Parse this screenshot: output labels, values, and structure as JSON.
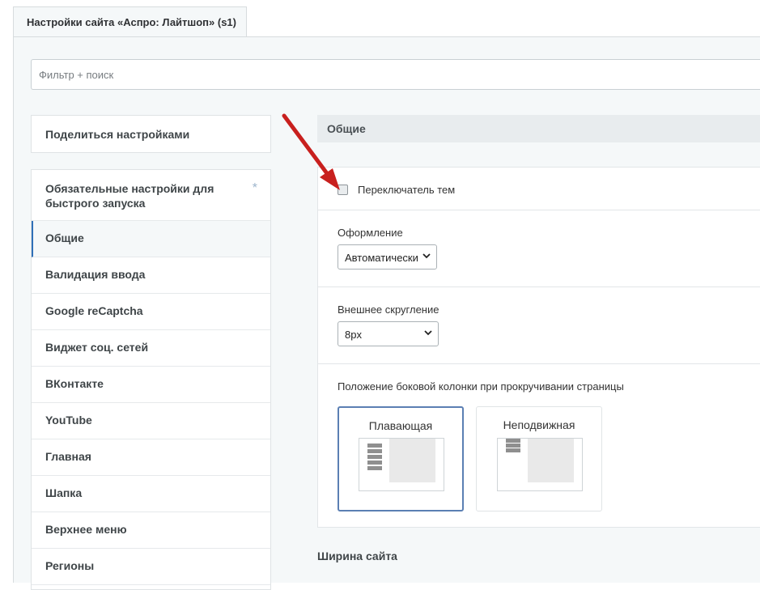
{
  "tab": {
    "title": "Настройки сайта «Аспро: Лайтшоп» (s1)"
  },
  "filter": {
    "placeholder": "Фильтр + поиск"
  },
  "share": {
    "label": "Поделиться настройками"
  },
  "sidebar": {
    "items": [
      {
        "label": "Обязательные настройки для быстрого запуска",
        "star": "*"
      },
      {
        "label": "Общие"
      },
      {
        "label": "Валидация ввода"
      },
      {
        "label": "Google reCaptcha"
      },
      {
        "label": "Виджет соц. сетей"
      },
      {
        "label": "ВКонтакте"
      },
      {
        "label": "YouTube"
      },
      {
        "label": "Главная"
      },
      {
        "label": "Шапка"
      },
      {
        "label": "Верхнее меню"
      },
      {
        "label": "Регионы"
      }
    ],
    "active_index": 1
  },
  "main": {
    "section_title": "Общие",
    "theme_switch": {
      "label": "Переключатель тем",
      "checked": false
    },
    "design": {
      "label": "Оформление",
      "value": "Автоматически"
    },
    "rounding": {
      "label": "Внешнее скругление",
      "value": "8px"
    },
    "sidebar_position": {
      "label": "Положение боковой колонки при прокручивании страницы",
      "options": [
        {
          "label": "Плавающая",
          "selected": true
        },
        {
          "label": "Неподвижная",
          "selected": false
        }
      ]
    },
    "width_section_title": "Ширина сайта"
  },
  "colors": {
    "accent": "#2f6fb7",
    "annotation_arrow": "#c8201e",
    "panel_bg": "#f5f8f9"
  }
}
